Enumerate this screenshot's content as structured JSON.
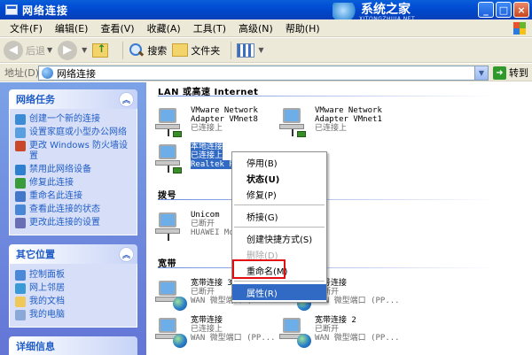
{
  "window": {
    "title": "网络连接",
    "watermark_main": "系统之家",
    "watermark_sub": "XITONGZHIJIA.NET",
    "minimize": "_",
    "maximize": "□",
    "close": "×"
  },
  "menubar": {
    "items": [
      "文件(F)",
      "编辑(E)",
      "查看(V)",
      "收藏(A)",
      "工具(T)",
      "高级(N)",
      "帮助(H)"
    ]
  },
  "toolbar": {
    "back": "后退",
    "search": "搜索",
    "folders": "文件夹"
  },
  "addressbar": {
    "label": "地址(D)",
    "value": "网络连接",
    "go": "转到"
  },
  "leftpane": {
    "network_tasks": {
      "title": "网络任务",
      "items": [
        "创建一个新的连接",
        "设置家庭或小型办公网络",
        "更改 Windows 防火墙设置",
        "禁用此网络设备",
        "修复此连接",
        "重命名此连接",
        "查看此连接的状态",
        "更改此连接的设置"
      ]
    },
    "other_places": {
      "title": "其它位置",
      "items": [
        "控制面板",
        "网上邻居",
        "我的文档",
        "我的电脑"
      ]
    },
    "details": {
      "title": "详细信息"
    }
  },
  "content": {
    "group_lan": "LAN 或高速 Internet",
    "group_dialup": "拨号",
    "group_broadband": "宽带",
    "lan": [
      {
        "name": "VMware Network",
        "line2": "Adapter VMnet8",
        "line3": "已连接上"
      },
      {
        "name": "VMware Network",
        "line2": "Adapter VMnet1",
        "line3": "已连接上"
      },
      {
        "name": "本地连接",
        "line2": "已连接上",
        "line3": "Realtek R"
      }
    ],
    "dialup": [
      {
        "name": "Unicom",
        "line2": "已断开",
        "line3": "HUAWEI Mo"
      }
    ],
    "broadband": [
      {
        "name": "宽带连接 3",
        "line2": "已断开",
        "line3": "WAN 微型端口 (PP..."
      },
      {
        "name": "拨号连接",
        "line2": "已断开",
        "line3": "WAN 微型端口 (PP..."
      },
      {
        "name": "宽带连接",
        "line2": "已连接上",
        "line3": "WAN 微型端口 (PP..."
      },
      {
        "name": "宽带连接 2",
        "line2": "已断开",
        "line3": "WAN 微型端口 (PP..."
      }
    ]
  },
  "context_menu": {
    "items": [
      {
        "label": "停用(B)"
      },
      {
        "label": "状态(U)"
      },
      {
        "label": "修复(P)"
      },
      {
        "label": "桥接(G)"
      },
      {
        "label": "创建快捷方式(S)"
      },
      {
        "label": "删除(D)"
      },
      {
        "label": "重命名(M)"
      },
      {
        "label": "属性(R)"
      }
    ]
  },
  "colors": {
    "title_bar": "#0046c8",
    "task_pane": "#6e8fdf",
    "selection": "#316ac5",
    "highlight_box": "#e01010"
  }
}
